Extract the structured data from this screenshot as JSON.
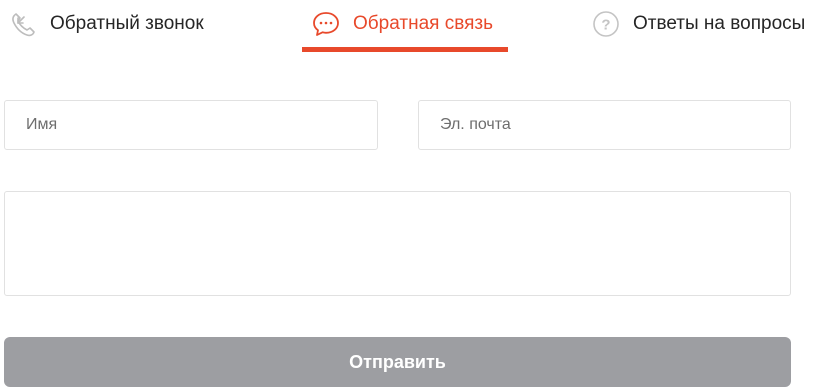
{
  "tabs": [
    {
      "label": "Обратный звонок",
      "icon": "phone-callback-icon",
      "active": false
    },
    {
      "label": "Обратная связь",
      "icon": "chat-bubble-icon",
      "active": true
    },
    {
      "label": "Ответы на вопросы",
      "icon": "question-circle-icon",
      "active": false
    }
  ],
  "form": {
    "name_placeholder": "Имя",
    "email_placeholder": "Эл. почта",
    "message_placeholder": "",
    "submit_label": "Отправить"
  },
  "colors": {
    "accent": "#e8492b",
    "text": "#262626",
    "border": "#e1e1e1",
    "button_disabled": "#9d9ea2"
  }
}
